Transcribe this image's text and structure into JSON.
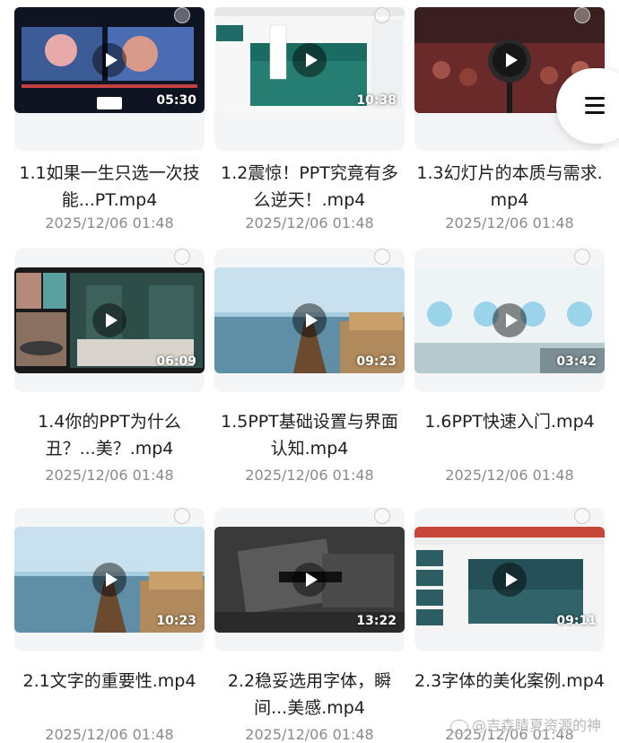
{
  "videos": [
    {
      "title": "1.1如果一生只选一次技能...PT.mp4",
      "date": "2025/12/06 01:48",
      "duration": "05:30"
    },
    {
      "title": "1.2震惊！PPT究竟有多么逆天！.mp4",
      "date": "2025/12/06 01:48",
      "duration": "10:38"
    },
    {
      "title": "1.3幻灯片的本质与需求.mp4",
      "date": "2025/12/06 01:48",
      "duration": ""
    },
    {
      "title": "1.4你的PPT为什么丑？...美？.mp4",
      "date": "2025/12/06 01:48",
      "duration": "06:09"
    },
    {
      "title": "1.5PPT基础设置与界面认知.mp4",
      "date": "2025/12/06 01:48",
      "duration": "09:23"
    },
    {
      "title": "1.6PPT快速入门.mp4",
      "date": "2025/12/06 01:48",
      "duration": "03:42"
    },
    {
      "title": "2.1文字的重要性.mp4",
      "date": "2025/12/06 01:48",
      "duration": "10:23"
    },
    {
      "title": "2.2稳妥选用字体，瞬间...美感.mp4",
      "date": "2025/12/06 01:48",
      "duration": "13:22"
    },
    {
      "title": "2.3字体的美化案例.mp4",
      "date": "2025/12/06 01:48",
      "duration": "09:11"
    }
  ],
  "watermark": "@吉森睛夏资源的神",
  "menu_icon": "hamburger-menu-icon",
  "colors": {
    "background": "#ffffff",
    "title": "#1e1e1e",
    "date": "#8a8a8a"
  }
}
